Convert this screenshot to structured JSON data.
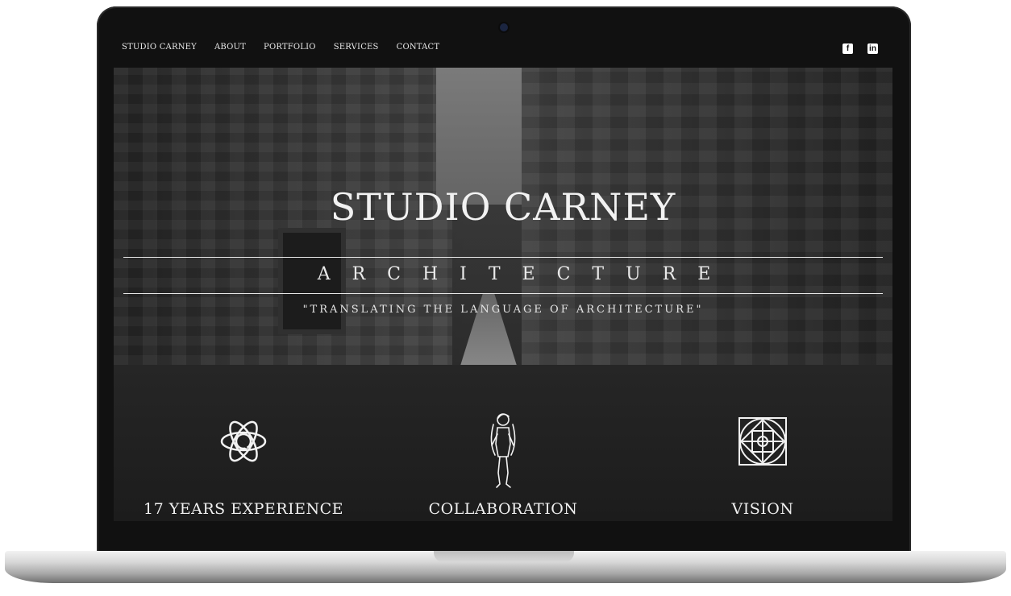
{
  "nav": {
    "links": [
      "Studio Carney",
      "About",
      "Portfolio",
      "Services",
      "Contact"
    ],
    "social": [
      {
        "icon": "facebook-icon",
        "glyph": "f"
      },
      {
        "icon": "linkedin-icon",
        "glyph": "in"
      }
    ]
  },
  "hero": {
    "title": "Studio Carney",
    "subtitle": "Architecture",
    "tagline": "\"Translating the language of architecture\""
  },
  "features": [
    {
      "label": "17 Years Experience",
      "icon": "knot-emblem-icon"
    },
    {
      "label": "Collaboration",
      "icon": "figure-illustration-icon"
    },
    {
      "label": "Vision",
      "icon": "celtic-square-icon"
    }
  ],
  "colors": {
    "screen_bg": "#1a1a1a",
    "nav_bg": "#111111",
    "text": "#f2f2f2"
  }
}
